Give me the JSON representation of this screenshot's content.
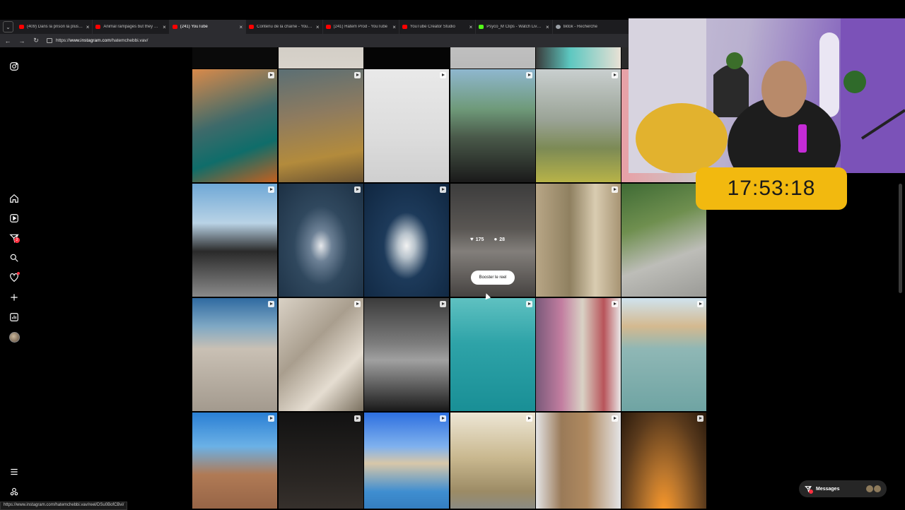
{
  "browser": {
    "tabs": [
      {
        "label": "(409) Dans la prison la plus surp",
        "favicon_color": "#ff0000",
        "active": false
      },
      {
        "label": "Animal rampages but they get a",
        "favicon_color": "#ff0000",
        "active": false
      },
      {
        "label": "(241) YouTube",
        "favicon_color": "#ff0000",
        "active": true
      },
      {
        "label": "Contenu de la chaîne - YouTube",
        "favicon_color": "#ff0000",
        "active": false
      },
      {
        "label": "(241) Hatem Prod - YouTube",
        "favicon_color": "#ff0000",
        "active": false
      },
      {
        "label": "YouTube Creator Studio",
        "favicon_color": "#ff0000",
        "active": false
      },
      {
        "label": "Psyco_M Clips - Watch Live on K",
        "favicon_color": "#53fc18",
        "active": false
      },
      {
        "label": "tiktok - Recherche",
        "favicon_color": "#9aa0a6",
        "active": false
      }
    ],
    "url_prefix": "https://",
    "url_host": "www.instagram.com",
    "url_path": "/hatemchebbi.vav/",
    "status_url": "https://www.instagram.com/hatemchebbi.vav/reel/DSu0BofCBvi/"
  },
  "sidebar": {
    "notification_count": "2",
    "icons": [
      "instagram-logo-icon",
      "home-icon",
      "reels-icon",
      "send-icon",
      "search-icon",
      "heart-icon",
      "create-icon",
      "dashboard-icon",
      "profile-avatar",
      "menu-icon",
      "threads-icon"
    ]
  },
  "grid": {
    "hovered_post": {
      "likes": "175",
      "comments": "28",
      "boost_label": "Booster le reel"
    }
  },
  "overlay": {
    "timer": "17:53:18"
  },
  "messages": {
    "label": "Messages"
  },
  "colors": {
    "timer_bg": "#f2b90f",
    "notification_red": "#ff3040",
    "browser_bg": "#1c1c1f"
  }
}
